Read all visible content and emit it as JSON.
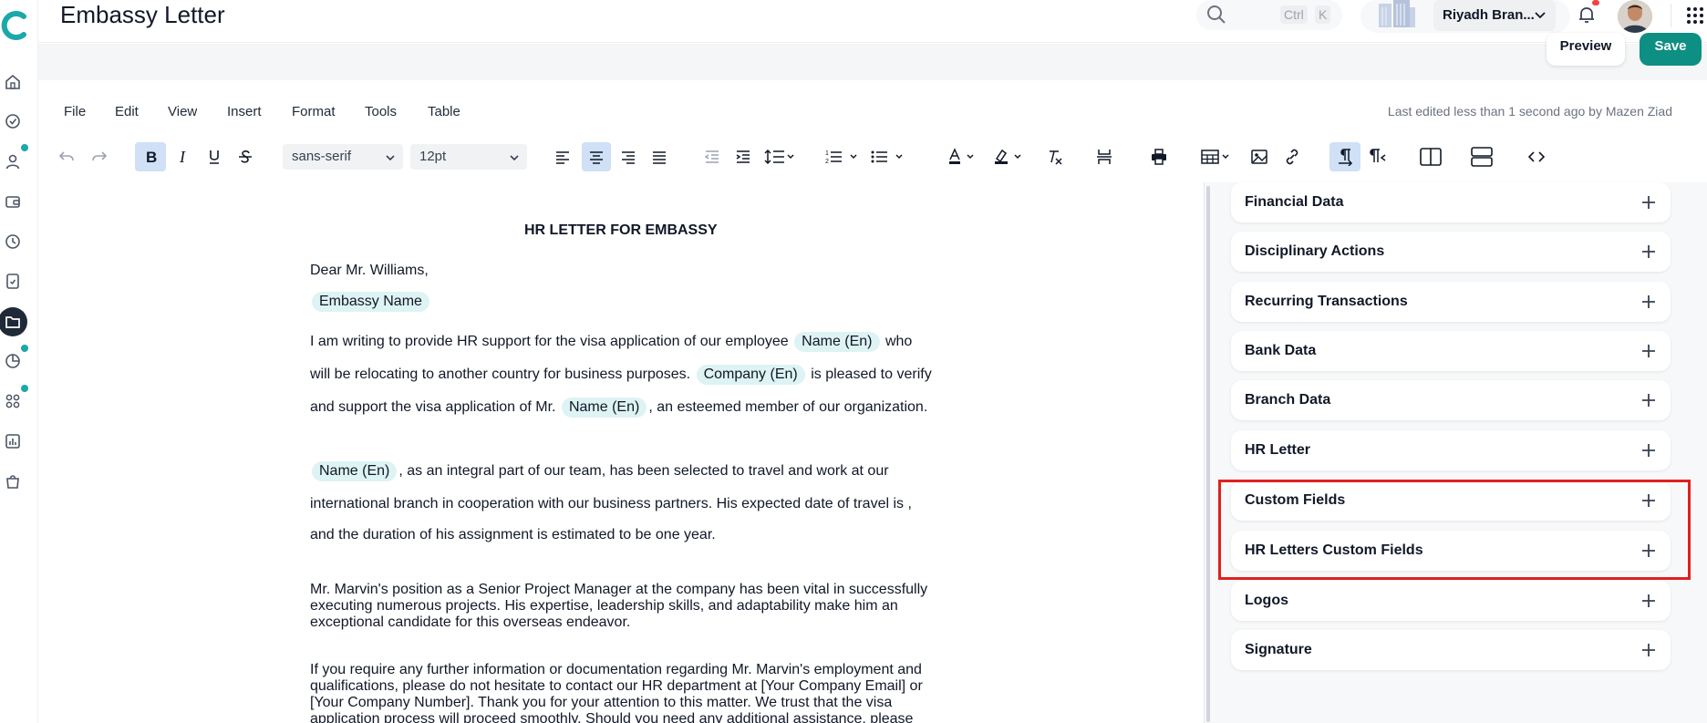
{
  "header": {
    "title": "Embassy Letter",
    "shortcut_ctrl": "Ctrl",
    "shortcut_k": "K",
    "branch": "Riyadh Bran...",
    "preview_label": "Preview",
    "save_label": "Save"
  },
  "menubar": {
    "items": [
      "File",
      "Edit",
      "View",
      "Insert",
      "Format",
      "Tools",
      "Table"
    ],
    "last_edited": "Last edited less than 1 second ago by Mazen Ziad"
  },
  "toolbar": {
    "font_family": "sans-serif",
    "font_size": "12pt",
    "accent_active_bg": "#cfe0f7"
  },
  "document": {
    "title": "HR LETTER FOR EMBASSY",
    "greeting": "Dear Mr. Williams,",
    "chip_embassy": "Embassy Name",
    "chip_name": "Name (En)",
    "chip_company": "Company (En)",
    "p1a": "I am writing to provide HR support for the visa application of our employee",
    "p1b": "who",
    "p1c": "will be relocating to another country for business purposes.",
    "p1d": "is pleased to verify",
    "p1e": "and support the visa application of Mr.",
    "p1f": ", an esteemed member of our organization.",
    "p2a": ", as an integral part of our team, has been selected to travel and work at our",
    "p2b": "international branch in cooperation with our business partners. His expected date of travel is ,",
    "p2c": "and the duration of his assignment is estimated to be one year.",
    "p3": "Mr. Marvin's position as a Senior Project Manager at the company has been vital in successfully executing numerous projects. His expertise, leadership skills, and adaptability make him an exceptional candidate for this overseas endeavor.",
    "p4": "If you require any further information or documentation regarding Mr. Marvin's employment and qualifications, please do not hesitate to contact our HR department at [Your Company Email] or [Your Company Number]. Thank you for your attention to this matter. We trust that the visa application process will proceed smoothly. Should you need any additional assistance, please"
  },
  "panel": {
    "sections": [
      "Financial Data",
      "Disciplinary Actions",
      "Recurring Transactions",
      "Bank Data",
      "Branch Data",
      "HR Letter",
      "Custom Fields",
      "HR Letters Custom Fields",
      "Logos",
      "Signature"
    ]
  },
  "colors": {
    "brand": "#1ba8a8",
    "save_button": "#0e8f83",
    "chip": "#def3f3",
    "highlight_box": "#e02020"
  }
}
